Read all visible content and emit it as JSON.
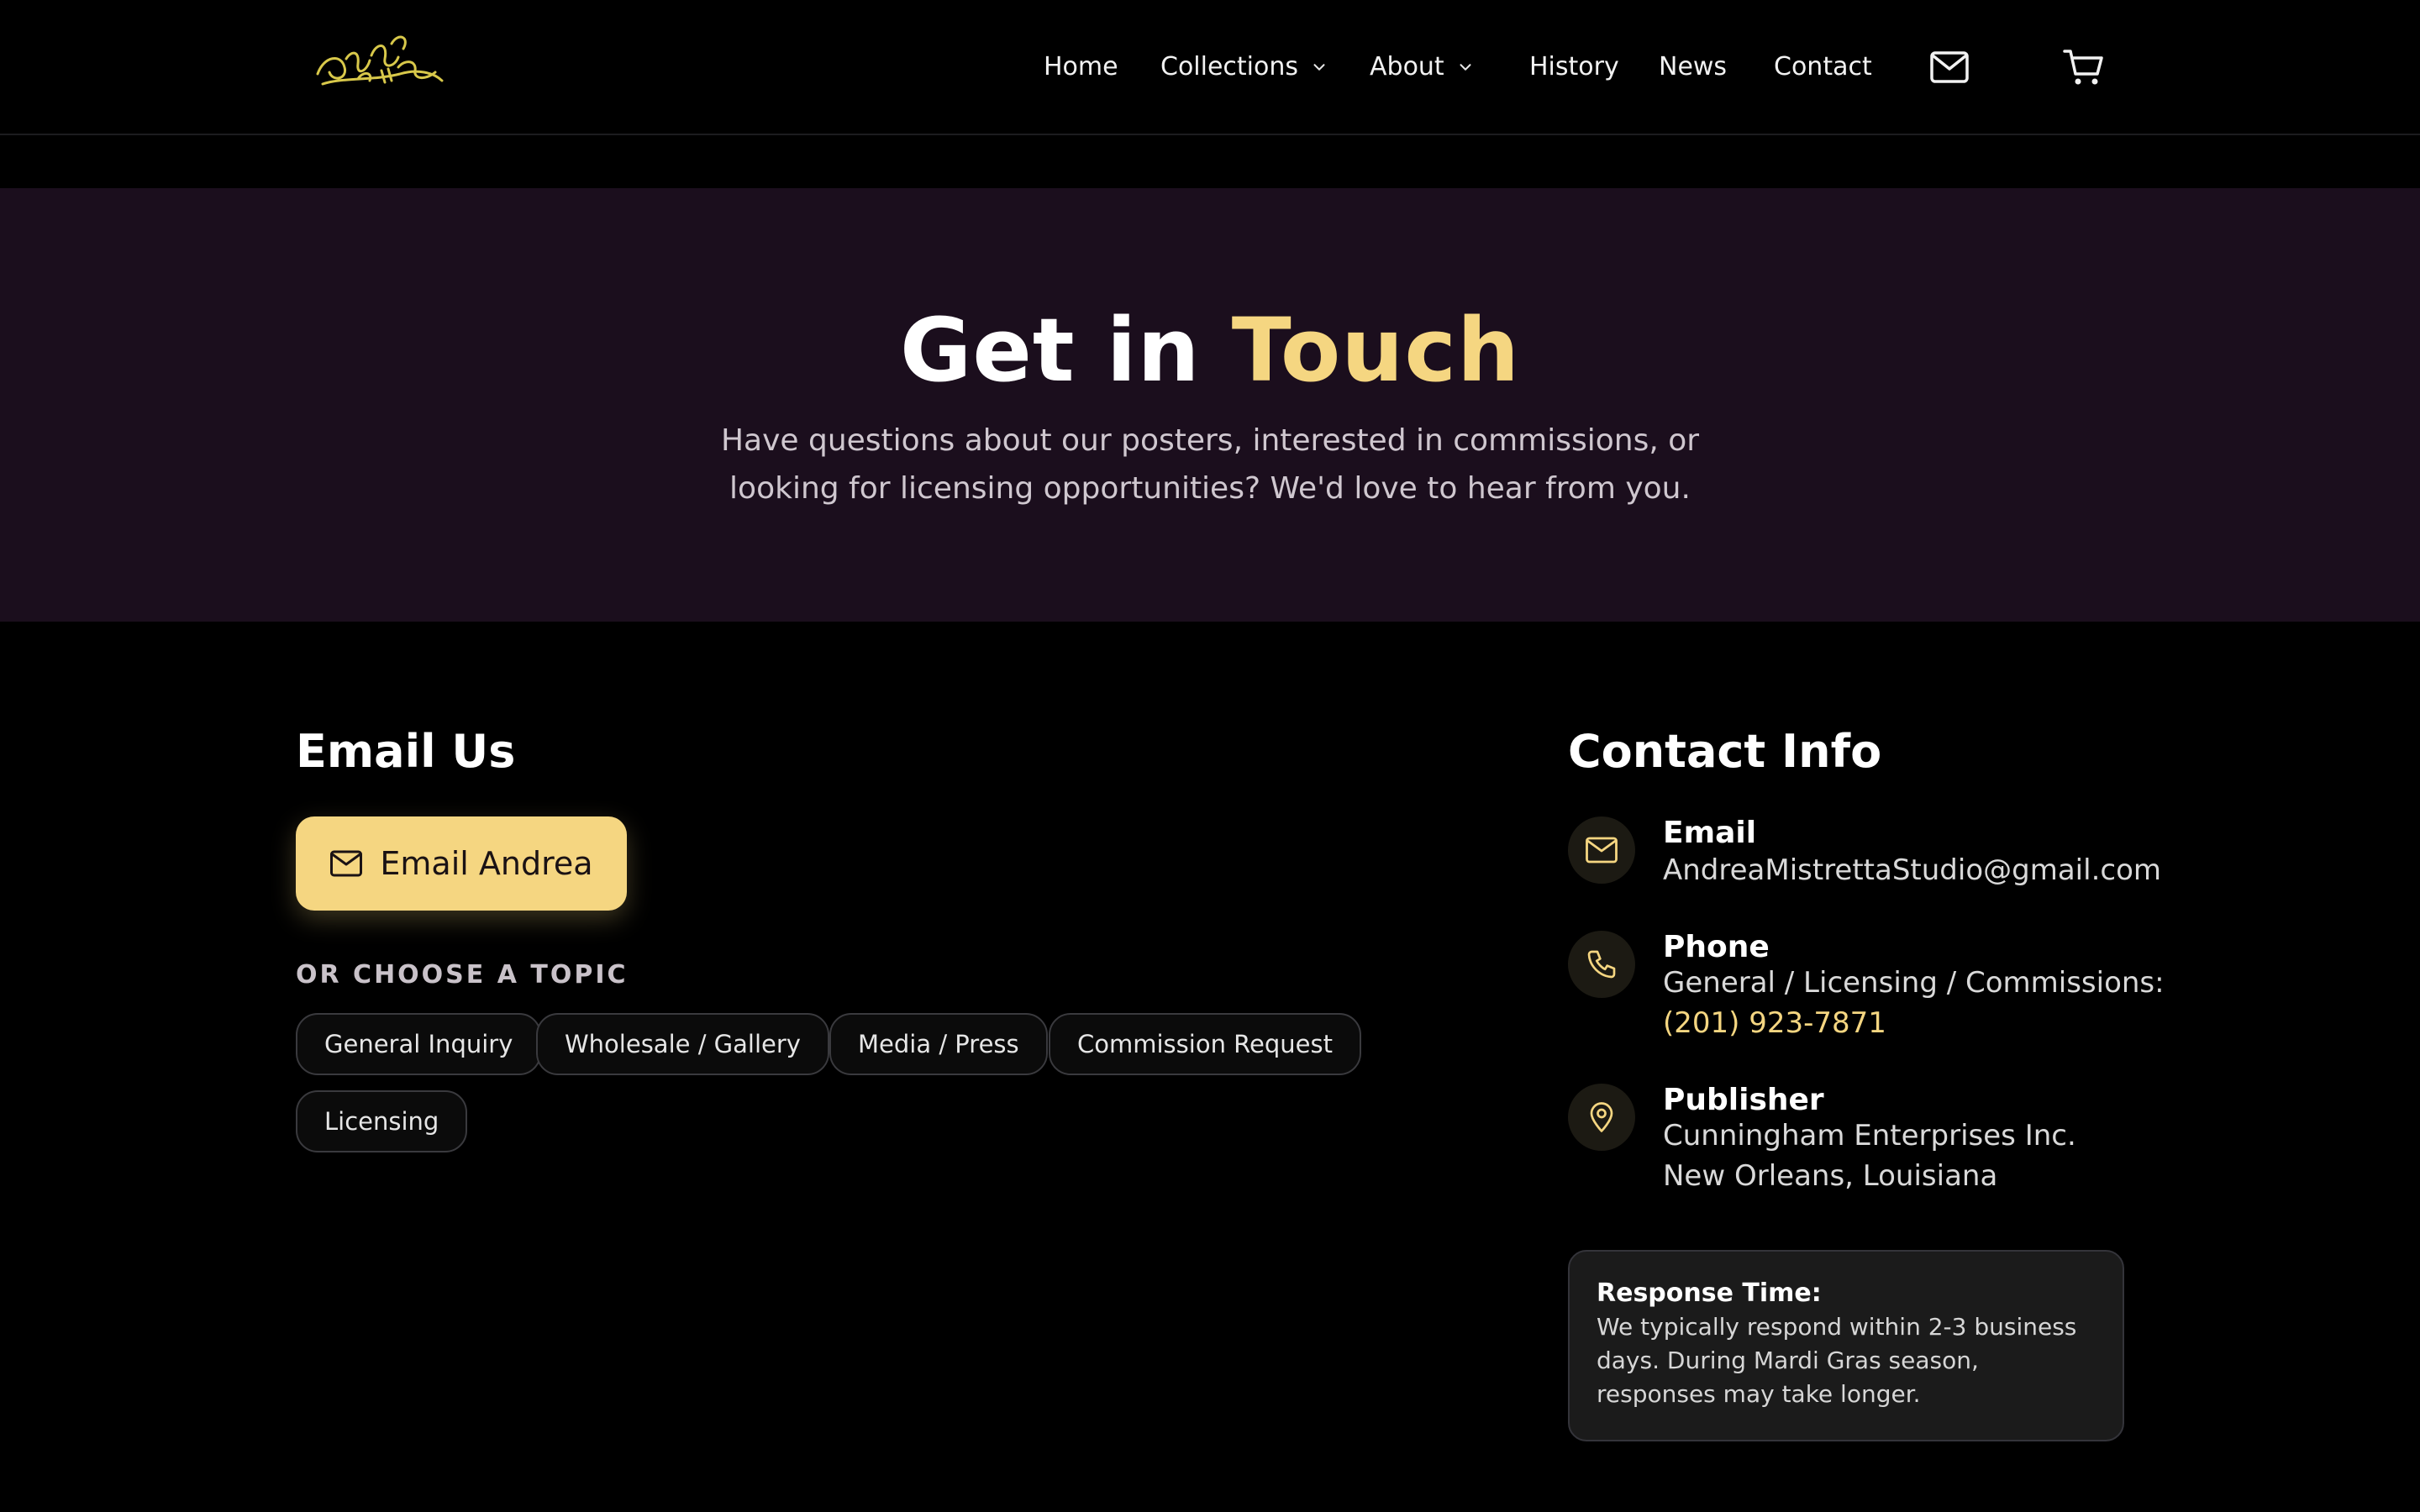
{
  "header": {
    "logo_text": "Andrea Mistretta",
    "nav": [
      {
        "label": "Home"
      },
      {
        "label": "Collections"
      },
      {
        "label": "About"
      },
      {
        "label": "History"
      },
      {
        "label": "News"
      },
      {
        "label": "Contact"
      }
    ],
    "icons": {
      "mail": "mail-icon",
      "cart": "cart-icon"
    }
  },
  "hero": {
    "title_main": "Get in ",
    "title_accent": "Touch",
    "subtitle": "Have questions about our posters, interested in commissions, or looking for licensing opportunities? We'd love to hear from you."
  },
  "email_section": {
    "heading": "Email Us",
    "button_label": "Email Andrea",
    "topic_label": "OR CHOOSE A TOPIC",
    "topics": [
      "General Inquiry",
      "Wholesale / Gallery",
      "Media / Press",
      "Commission Request",
      "Licensing"
    ]
  },
  "contact_info": {
    "heading": "Contact Info",
    "email": {
      "title": "Email",
      "value": "AndreaMistrettaStudio@gmail.com"
    },
    "phone": {
      "title": "Phone",
      "line1": "General / Licensing / Commissions:",
      "number": "(201) 923-7871"
    },
    "publisher": {
      "title": "Publisher",
      "line1": "Cunningham Enterprises Inc.",
      "line2": "New Orleans, Louisiana"
    },
    "response": {
      "title": "Response Time:",
      "text": "We typically respond within 2-3 business days. During Mardi Gras season, responses may take longer."
    }
  },
  "colors": {
    "accent": "#f5d681",
    "hero_bg": "#1b0e1d",
    "page_bg": "#000000"
  }
}
